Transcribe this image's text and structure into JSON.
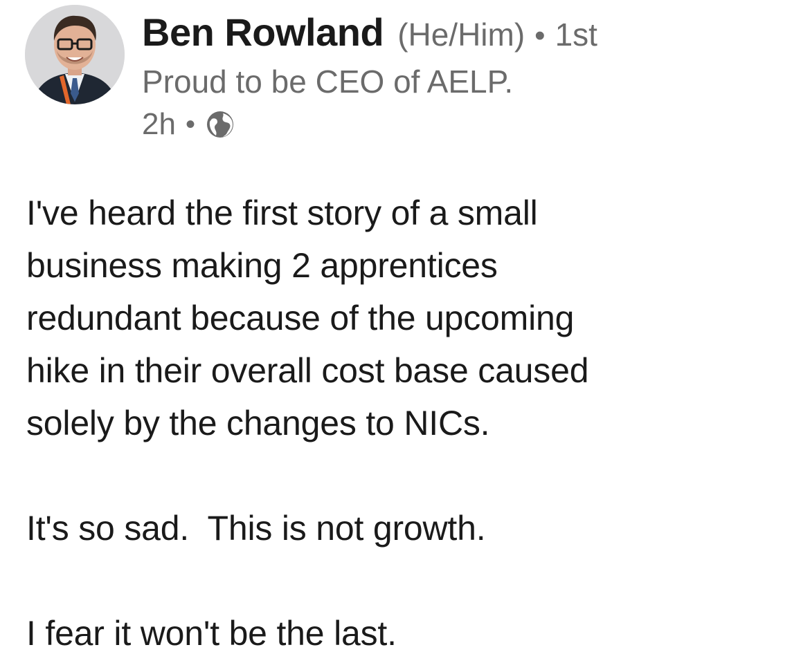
{
  "post": {
    "author": {
      "name": "Ben Rowland",
      "pronouns": "(He/Him)",
      "degree": "1st",
      "headline": "Proud to be CEO of AELP.",
      "avatar_icon": "profile-photo"
    },
    "meta": {
      "time_ago": "2h",
      "visibility_icon": "globe-icon"
    },
    "separator": "•",
    "paragraphs": [
      "I've heard the first story of a small\nbusiness making 2 apprentices\nredundant because of the upcoming\nhike in their overall cost base caused\nsolely by the changes to NICs.",
      "It's so sad.  This is not growth.",
      "I fear it won't be the last."
    ]
  },
  "colors": {
    "text_primary": "#1a1a1a",
    "text_secondary": "#6b6b6b",
    "background": "#ffffff"
  }
}
